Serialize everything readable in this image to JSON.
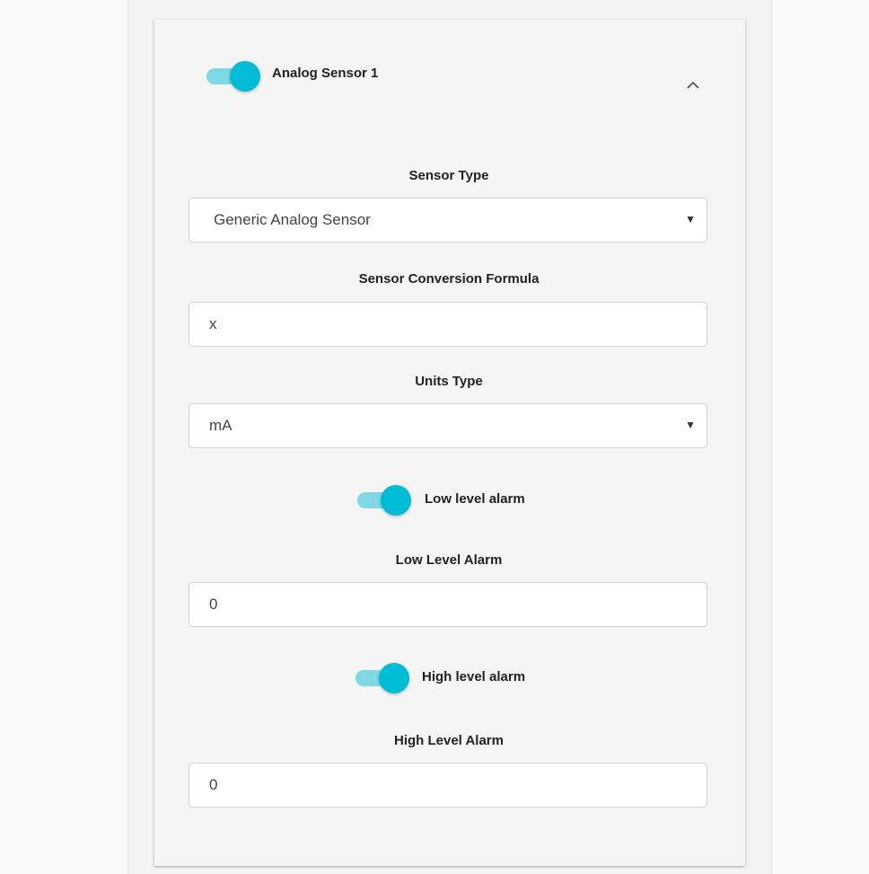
{
  "header": {
    "sensor_toggle_on": true,
    "sensor_title": "Analog Sensor 1"
  },
  "sensor_type": {
    "label": "Sensor Type",
    "value": "Generic Analog Sensor"
  },
  "conversion_formula": {
    "label": "Sensor Conversion Formula",
    "value": "x"
  },
  "units_type": {
    "label": "Units Type",
    "value": "mA"
  },
  "low_alarm": {
    "toggle_label": "Low level alarm",
    "toggle_on": true,
    "field_label": "Low Level Alarm",
    "value": "0"
  },
  "high_alarm": {
    "toggle_label": "High level alarm",
    "toggle_on": true,
    "field_label": "High Level Alarm",
    "value": "0"
  },
  "colors": {
    "toggle_thumb": "#00bcd4",
    "toggle_track": "#7fd8e3"
  },
  "icons": {
    "collapse": "chevron-up-icon",
    "dropdown": "caret-down-icon"
  }
}
